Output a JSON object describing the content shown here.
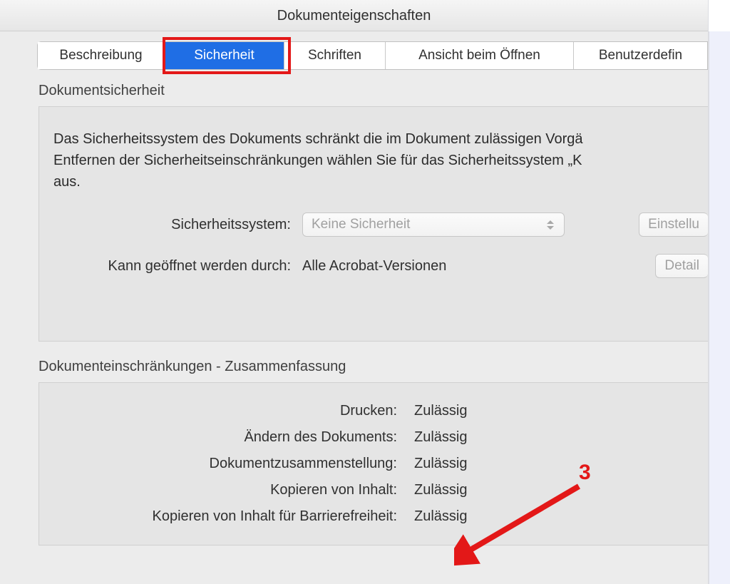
{
  "window_title": "Dokumenteigenschaften",
  "tabs": {
    "beschreibung": "Beschreibung",
    "sicherheit": "Sicherheit",
    "schriften": "Schriften",
    "ansicht": "Ansicht beim Öffnen",
    "benutzerdef": "Benutzerdefin"
  },
  "security": {
    "group_title": "Dokumentsicherheit",
    "description": "Das Sicherheitssystem des Dokuments schränkt die im Dokument zulässigen Vorgä\nEntfernen der Sicherheitseinschränkungen wählen Sie für das Sicherheitssystem „K\naus.",
    "system_label": "Sicherheitssystem:",
    "system_value": "Keine Sicherheit",
    "settings_button": "Einstellu",
    "open_label": "Kann geöffnet werden durch:",
    "open_value": "Alle Acrobat-Versionen",
    "details_button": "Detail"
  },
  "restrictions": {
    "group_title": "Dokumenteinschränkungen - Zusammenfassung",
    "rows": [
      {
        "label": "Drucken:",
        "value": "Zulässig"
      },
      {
        "label": "Ändern des Dokuments:",
        "value": "Zulässig"
      },
      {
        "label": "Dokumentzusammenstellung:",
        "value": "Zulässig"
      },
      {
        "label": "Kopieren von Inhalt:",
        "value": "Zulässig"
      },
      {
        "label": "Kopieren von Inhalt für Barrierefreiheit:",
        "value": "Zulässig"
      }
    ]
  },
  "annotation": {
    "number": "3"
  }
}
